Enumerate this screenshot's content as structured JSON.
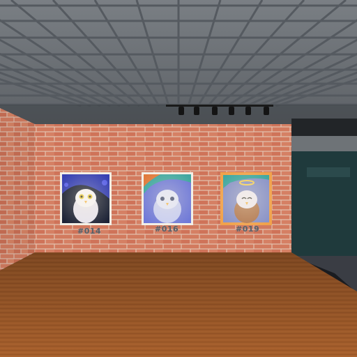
{
  "gallery": {
    "artworks": [
      {
        "id": "art-014",
        "label": "#014",
        "frame_color": "#f3efe6",
        "bg": "#1c2236",
        "accent": "#3b45c9"
      },
      {
        "id": "art-016",
        "label": "#016",
        "frame_color": "#f3efe6",
        "bg": "#6f79d8",
        "accent": "#3fa7a0"
      },
      {
        "id": "art-019",
        "label": "#019",
        "frame_color": "#f0a24c",
        "bg": "#8a93c8",
        "accent": "#3fa7a0"
      }
    ]
  },
  "colors": {
    "brick": "#d27a5e",
    "mortar": "#e5c4b2",
    "floor": "#a05d2c",
    "ceiling": "#6f7479",
    "teal_wall": "#1f3a3c"
  }
}
